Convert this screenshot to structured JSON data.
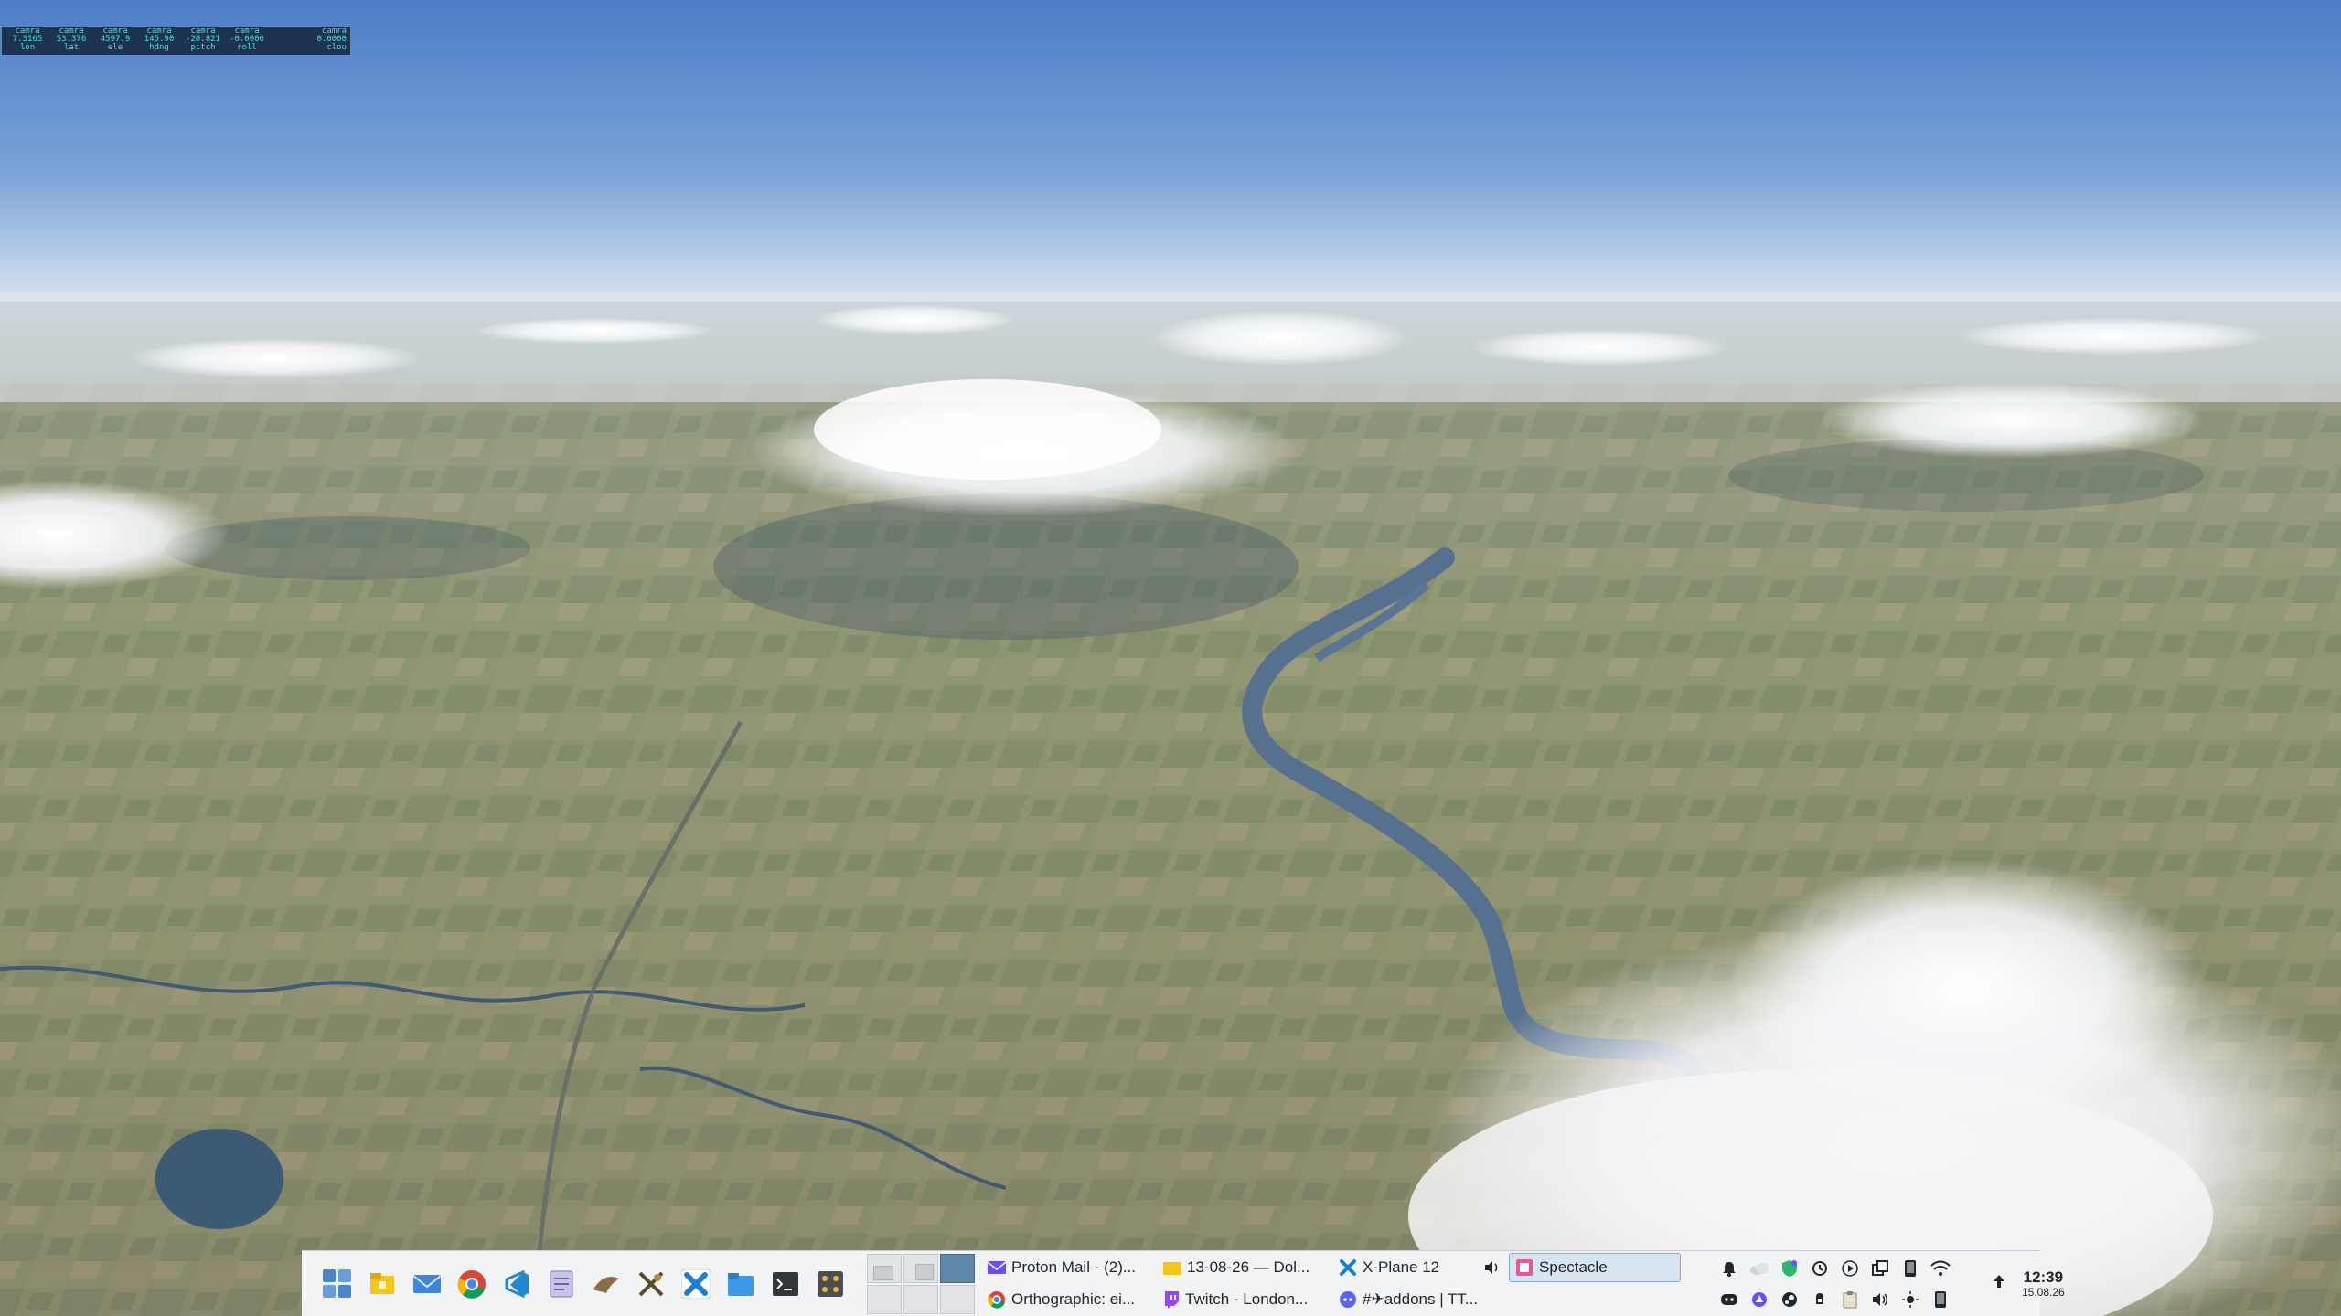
{
  "dataref": {
    "columns": [
      {
        "label": "camra",
        "value": "7.3165",
        "unit": "lon"
      },
      {
        "label": "camra",
        "value": "53.376",
        "unit": "lat"
      },
      {
        "label": "camra",
        "value": "4597.9",
        "unit": "ele"
      },
      {
        "label": "camra",
        "value": "145.90",
        "unit": "hdng"
      },
      {
        "label": "camra",
        "value": "-20.821",
        "unit": "pitch"
      },
      {
        "label": "camra",
        "value": "-0.0000",
        "unit": "roll"
      }
    ],
    "last": {
      "label": "camra",
      "value": "0.0000",
      "unit": "clou"
    }
  },
  "taskbar": {
    "launchers": [
      {
        "name": "app-menu-icon"
      },
      {
        "name": "notes-folder-icon"
      },
      {
        "name": "mail-icon"
      },
      {
        "name": "chrome-icon"
      },
      {
        "name": "vscode-icon"
      },
      {
        "name": "text-editor-icon"
      },
      {
        "name": "bird-app-icon"
      },
      {
        "name": "xplane-tool-icon"
      },
      {
        "name": "xplane-icon"
      },
      {
        "name": "files-icon"
      },
      {
        "name": "terminal-icon"
      },
      {
        "name": "mixer-icon"
      }
    ],
    "tasks": [
      {
        "label": "Proton Mail - (2)...",
        "icon": "mail-icon",
        "active": false
      },
      {
        "label": "13-08-26 — Dol...",
        "icon": "folder-icon",
        "active": false
      },
      {
        "label": "X-Plane 12",
        "icon": "xplane-icon",
        "active": false,
        "audio": true
      },
      {
        "label": "Spectacle",
        "icon": "spectacle-icon",
        "active": true
      },
      {
        "label": "Orthographic: ei...",
        "icon": "chrome-icon",
        "active": false
      },
      {
        "label": "Twitch - London...",
        "icon": "twitch-icon",
        "active": false
      },
      {
        "label": "#✈addons | TT...",
        "icon": "discord-icon",
        "active": false
      }
    ],
    "clock": {
      "time": "12:39",
      "date": "15.08.26"
    }
  }
}
